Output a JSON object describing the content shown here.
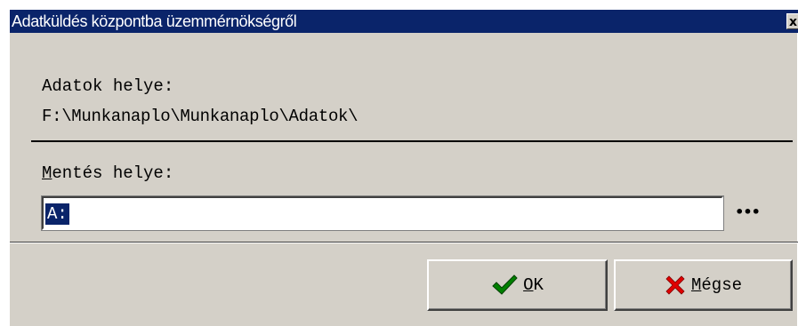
{
  "window": {
    "title": "Adatküldés központba üzemmérnökségről",
    "close_symbol": "x"
  },
  "source": {
    "label": "Adatok helye:",
    "path": "F:\\Munkanaplo\\Munkanaplo\\Adatok\\"
  },
  "destination": {
    "label_mnemonic": "M",
    "label_rest": "entés helye:",
    "value": "A:",
    "browse_label": "•••"
  },
  "buttons": {
    "ok": {
      "mnemonic": "O",
      "rest": "K",
      "icon": "checkmark-icon",
      "icon_color": "#008000"
    },
    "cancel": {
      "mnemonic": "M",
      "rest": "égse",
      "icon": "x-mark-icon",
      "icon_color": "#e00000"
    }
  },
  "colors": {
    "titlebar": "#0a246a",
    "face": "#d4d0c8",
    "selection": "#0a246a"
  }
}
